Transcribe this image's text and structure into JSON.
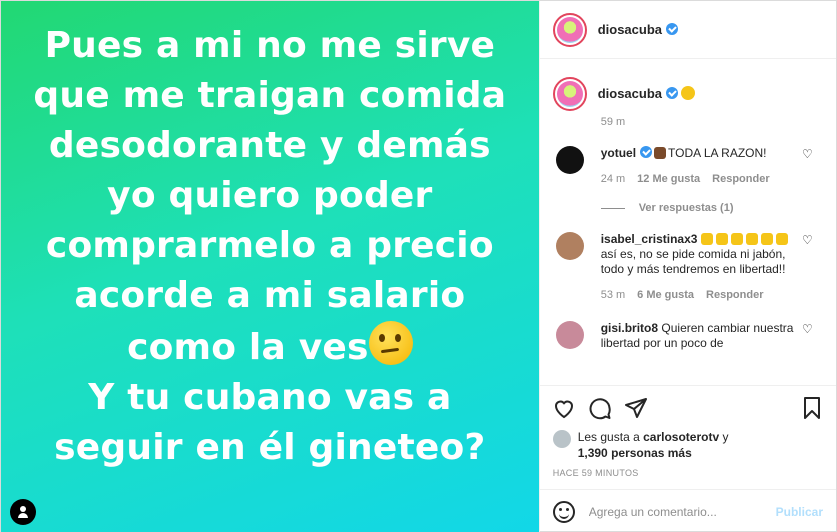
{
  "media": {
    "text_lines": [
      "Pues a mi no me sirve",
      "que me traigan comida",
      "desodorante y demás",
      "yo quiero poder",
      "comprarmelo a precio",
      "acorde a mi salario",
      "como la ves",
      "Y tu cubano vas a",
      "seguir en él gineteo?"
    ]
  },
  "header": {
    "username": "diosacuba"
  },
  "caption": {
    "username": "diosacuba",
    "time": "59 m"
  },
  "comments": [
    {
      "username": "yotuel",
      "text": "TODA LA RAZON!",
      "time": "24 m",
      "likes": "12 Me gusta",
      "reply": "Responder",
      "view_replies": "Ver respuestas (1)"
    },
    {
      "username": "isabel_cristinax3",
      "text": "así es, no se pide comida ni jabón, todo y más tendremos en libertad!!",
      "time": "53 m",
      "likes": "6 Me gusta",
      "reply": "Responder"
    },
    {
      "username": "gisi.brito8",
      "text": "Quieren cambiar nuestra libertad por un poco de"
    }
  ],
  "likes": {
    "prefix": "Les gusta a",
    "user": "carlosoterotv",
    "and": "y",
    "count": "1,390 personas más"
  },
  "time_ago": "HACE 59 MINUTOS",
  "add_comment": {
    "placeholder": "Agrega un comentario...",
    "post_label": "Publicar"
  }
}
